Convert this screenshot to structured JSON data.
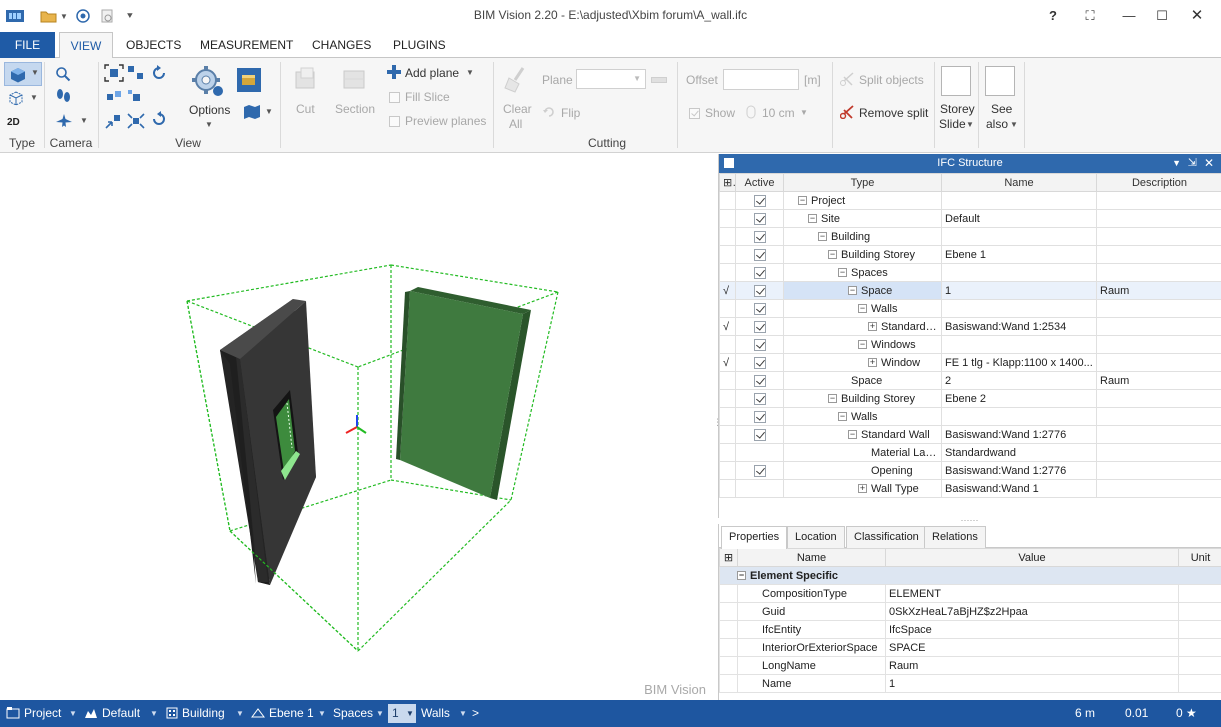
{
  "window": {
    "title": "BIM Vision 2.20 - E:\\adjusted\\Xbim forum\\A_wall.ifc",
    "help": "?"
  },
  "tabs": [
    "FILE",
    "VIEW",
    "OBJECTS",
    "MEASUREMENT",
    "CHANGES",
    "PLUGINS"
  ],
  "ribbon": {
    "type_group": "Type",
    "camera_group": "Camera",
    "view_group": "View",
    "cutting_group": "Cutting",
    "two_d": "2D",
    "options": "Options",
    "cut": "Cut",
    "section": "Section",
    "add_plane": "Add plane",
    "fill_slice": "Fill Slice",
    "preview_planes": "Preview planes",
    "clear": "Clear",
    "all": "All",
    "plane": "Plane",
    "flip": "Flip",
    "offset": "Offset",
    "offset_unit": "[m]",
    "show": "Show",
    "step": "10 cm",
    "split_objects": "Split objects",
    "remove_split": "Remove split",
    "storey": "Storey",
    "slide": "Slide",
    "see": "See",
    "also": "also"
  },
  "viewport": {
    "watermark": "BIM Vision"
  },
  "ifc": {
    "title": "IFC Structure",
    "columns": [
      "Active",
      "Type",
      "Name",
      "Description"
    ],
    "rows": [
      {
        "mark": "",
        "active": true,
        "toggle": "−",
        "type": "Project",
        "name": "",
        "desc": ""
      },
      {
        "mark": "",
        "active": true,
        "toggle": "−",
        "type": "Site",
        "name": "Default",
        "desc": ""
      },
      {
        "mark": "",
        "active": true,
        "toggle": "−",
        "type": "Building",
        "name": "",
        "desc": ""
      },
      {
        "mark": "",
        "active": true,
        "toggle": "−",
        "type": "Building Storey",
        "name": "Ebene 1",
        "desc": ""
      },
      {
        "mark": "",
        "active": true,
        "toggle": "−",
        "type": "Spaces",
        "name": "",
        "desc": ""
      },
      {
        "mark": "√",
        "active": true,
        "toggle": "−",
        "type": "Space",
        "name": "1",
        "desc": "Raum"
      },
      {
        "mark": "",
        "active": true,
        "toggle": "−",
        "type": "Walls",
        "name": "",
        "desc": ""
      },
      {
        "mark": "√",
        "active": true,
        "toggle": "+",
        "type": "Standard Wall",
        "name": "Basiswand:Wand 1:2534",
        "desc": ""
      },
      {
        "mark": "",
        "active": true,
        "toggle": "−",
        "type": "Windows",
        "name": "",
        "desc": ""
      },
      {
        "mark": "√",
        "active": true,
        "toggle": "+",
        "type": "Window",
        "name": "FE 1 tlg - Klapp:1100 x 1400...",
        "desc": ""
      },
      {
        "mark": "",
        "active": true,
        "toggle": "",
        "type": "Space",
        "name": "2",
        "desc": "Raum"
      },
      {
        "mark": "",
        "active": true,
        "toggle": "−",
        "type": "Building Storey",
        "name": "Ebene 2",
        "desc": ""
      },
      {
        "mark": "",
        "active": true,
        "toggle": "−",
        "type": "Walls",
        "name": "",
        "desc": ""
      },
      {
        "mark": "",
        "active": true,
        "toggle": "−",
        "type": "Standard Wall",
        "name": "Basiswand:Wand 1:2776",
        "desc": ""
      },
      {
        "mark": "",
        "active": false,
        "toggle": "",
        "type": "Material Layer",
        "name": "Standardwand",
        "desc": ""
      },
      {
        "mark": "",
        "active": true,
        "toggle": "",
        "type": "Opening",
        "name": "Basiswand:Wand 1:2776",
        "desc": ""
      },
      {
        "mark": "",
        "active": false,
        "toggle": "+",
        "type": "Wall Type",
        "name": "Basiswand:Wand 1",
        "desc": ""
      }
    ]
  },
  "props": {
    "tabs": [
      "Properties",
      "Location",
      "Classification",
      "Relations"
    ],
    "columns": [
      "Name",
      "Value",
      "Unit"
    ],
    "category": "Element Specific",
    "rows": [
      {
        "name": "CompositionType",
        "value": "ELEMENT"
      },
      {
        "name": "Guid",
        "value": "0SkXzHeaL7aBjHZ$z2Hpaa"
      },
      {
        "name": "IfcEntity",
        "value": "IfcSpace"
      },
      {
        "name": "InteriorOrExteriorSpace",
        "value": "SPACE"
      },
      {
        "name": "LongName",
        "value": "Raum"
      },
      {
        "name": "Name",
        "value": "1"
      }
    ]
  },
  "statusbar": {
    "crumbs": [
      "Project",
      "Default",
      "Building",
      "Ebene 1",
      "Spaces",
      "1",
      "Walls",
      ">"
    ],
    "distance": "6 m",
    "precision": "0.01",
    "angle": "0 ★"
  },
  "colors": {
    "accent": "#1f5ba6",
    "panel_header": "#2f69ad",
    "status_bar": "#1e56a0",
    "wall_dark": "#2d2d2d",
    "wall_green": "#3f7a3f",
    "bbox": "#22bb22"
  }
}
